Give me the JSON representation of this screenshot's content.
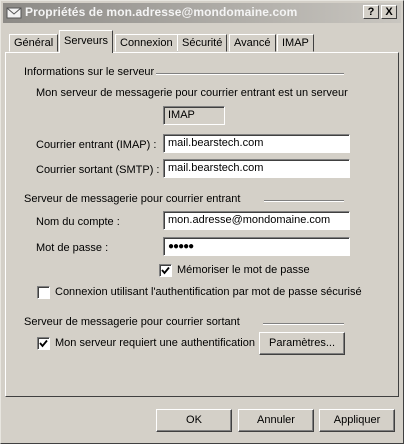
{
  "window": {
    "title": "Propriétés de mon.adresse@mondomaine.com",
    "help_button": "?",
    "close_button": "X"
  },
  "tabs": [
    "Général",
    "Serveurs",
    "Connexion",
    "Sécurité",
    "Avancé",
    "IMAP"
  ],
  "active_tab": "Serveurs",
  "server_info": {
    "group_label": "Informations sur le serveur",
    "incoming_type_label": "Mon serveur de messagerie pour courrier entrant est un serveur",
    "incoming_type_value": "IMAP",
    "incoming_label": "Courrier entrant (IMAP) :",
    "incoming_value": "mail.bearstech.com",
    "outgoing_label": "Courrier sortant (SMTP) :",
    "outgoing_value": "mail.bearstech.com"
  },
  "incoming_server": {
    "group_label": "Serveur de messagerie pour courrier entrant",
    "account_label": "Nom du compte :",
    "account_value": "mon.adresse@mondomaine.com",
    "password_label": "Mot de passe :",
    "password_value": "●●●●●",
    "remember_password_label": "Mémoriser le mot de passe",
    "remember_password_checked": true,
    "spa_label": "Connexion utilisant l'authentification par mot de passe sécurisé",
    "spa_checked": false
  },
  "outgoing_server": {
    "group_label": "Serveur de messagerie pour courrier sortant",
    "auth_label": "Mon serveur requiert une authentification",
    "auth_checked": true,
    "settings_button": "Paramètres..."
  },
  "footer": {
    "ok": "OK",
    "cancel": "Annuler",
    "apply": "Appliquer"
  }
}
